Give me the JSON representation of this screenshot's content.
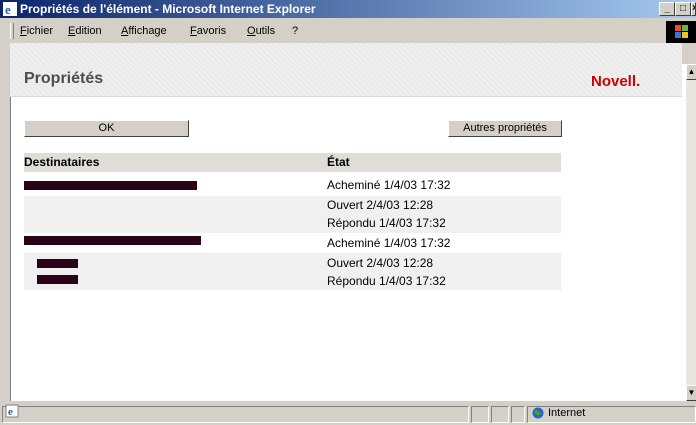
{
  "window": {
    "title": "Propriétés de l'élément - Microsoft Internet Explorer",
    "minimize_label": "_",
    "maximize_label": "□",
    "close_label": "×"
  },
  "menu": {
    "items": [
      "Fichier",
      "Edition",
      "Affichage",
      "Favoris",
      "Outils",
      "?"
    ]
  },
  "page": {
    "title": "Propriétés",
    "brand": "Novell."
  },
  "buttons": {
    "ok": "OK",
    "more": "Autres propriétés"
  },
  "table": {
    "headers": {
      "recipients": "Destinataires",
      "status": "État"
    },
    "rows": [
      {
        "recipient": "[masqué]",
        "status": [
          "Acheminé 1/4/03 17:32"
        ]
      },
      {
        "recipient": "",
        "status": [
          "Ouvert 2/4/03 12:28",
          "Répondu 1/4/03 17:32"
        ]
      },
      {
        "recipient": "[masqué]",
        "status": [
          "Acheminé 1/4/03 17:32"
        ]
      },
      {
        "recipient": "[masqué]",
        "status": [
          "Ouvert 2/4/03 12:28",
          "Répondu 1/4/03 17:32"
        ]
      }
    ]
  },
  "statusbar": {
    "zone": "Internet"
  },
  "colors": {
    "titlebar_start": "#0a246a",
    "titlebar_end": "#a6caf0",
    "brand_red": "#cc0000",
    "redaction": "#2a0318"
  }
}
